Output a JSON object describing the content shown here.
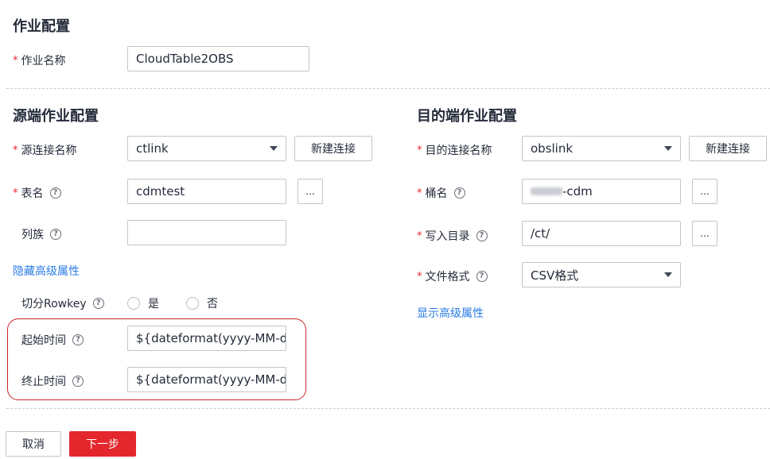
{
  "job_config": {
    "title": "作业配置",
    "job_name_label": "作业名称",
    "job_name_value": "CloudTable2OBS"
  },
  "source": {
    "title": "源端作业配置",
    "connection_label": "源连接名称",
    "connection_value": "ctlink",
    "new_connection_label": "新建连接",
    "table_label": "表名",
    "table_value": "cdmtest",
    "column_family_label": "列族",
    "column_family_value": "",
    "hide_advanced_label": "隐藏高级属性",
    "split_rowkey_label": "切分Rowkey",
    "split_rowkey_options": [
      "是",
      "否"
    ],
    "start_time_label": "起始时间",
    "start_time_value": "${dateformat(yyyy-MM-dd",
    "end_time_label": "终止时间",
    "end_time_value": "${dateformat(yyyy-MM-dd",
    "dots_label": "..."
  },
  "destination": {
    "title": "目的端作业配置",
    "connection_label": "目的连接名称",
    "connection_value": "obslink",
    "new_connection_label": "新建连接",
    "bucket_label": "桶名",
    "bucket_value": "-cdm",
    "write_dir_label": "写入目录",
    "write_dir_value": "/ct/",
    "file_format_label": "文件格式",
    "file_format_value": "CSV格式",
    "show_advanced_label": "显示高级属性",
    "dots_label": "..."
  },
  "footer": {
    "cancel_label": "取消",
    "next_label": "下一步"
  },
  "colors": {
    "required": "#e4272d",
    "link": "#2b7be6",
    "primary": "#e4272d",
    "highlight": "#c8262b"
  }
}
